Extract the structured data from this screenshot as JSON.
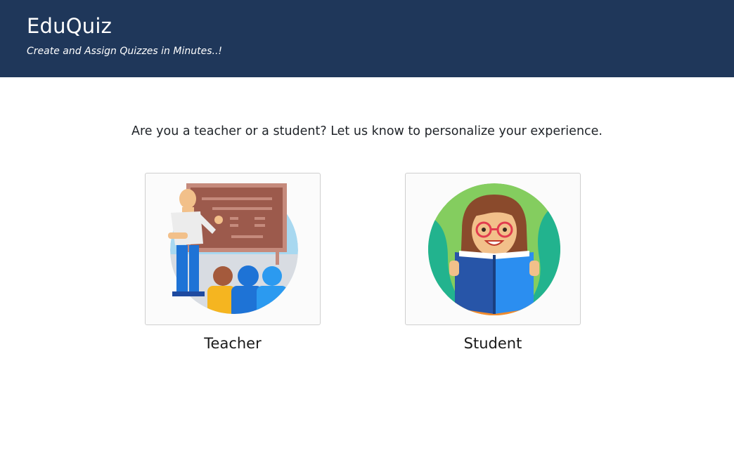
{
  "header": {
    "title": "EduQuiz",
    "tagline": "Create and Assign Quizzes in Minutes..!"
  },
  "main": {
    "prompt": "Are you a teacher or a student? Let us know to personalize your experience.",
    "roles": [
      {
        "id": "teacher",
        "label": "Teacher",
        "illustration": "teacher-classroom-illustration"
      },
      {
        "id": "student",
        "label": "Student",
        "illustration": "student-reading-illustration"
      }
    ]
  },
  "colors": {
    "header_bg": "#1f375a",
    "header_text": "#ffffff",
    "card_border": "#cfcfcf"
  }
}
